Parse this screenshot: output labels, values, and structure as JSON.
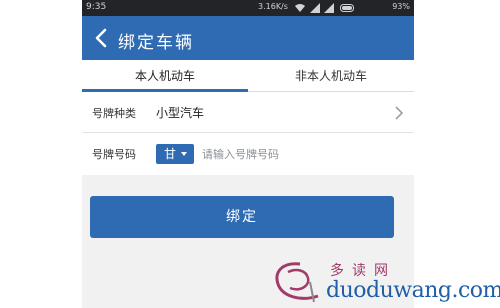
{
  "statusbar": {
    "time": "9:35",
    "speed": "3.16K/s",
    "battery": "93%"
  },
  "header": {
    "title": "绑定车辆",
    "back_icon": "back-arrow-icon"
  },
  "tabs": [
    {
      "label": "本人机动车",
      "active": true
    },
    {
      "label": "非本人机动车",
      "active": false
    }
  ],
  "form": {
    "plate_type": {
      "label": "号牌种类",
      "value": "小型汽车",
      "icon": "chevron-right-icon"
    },
    "plate_number": {
      "label": "号牌号码",
      "region": "甘",
      "placeholder": "请输入号牌号码",
      "value": ""
    }
  },
  "actions": {
    "bind_label": "绑定"
  },
  "watermark": {
    "cn_text": "多读网",
    "url_text": "duoduwang.com"
  },
  "colors": {
    "primary": "#2f6bb3",
    "statusbar": "#232428",
    "gray_bg": "#f1f1f1"
  }
}
